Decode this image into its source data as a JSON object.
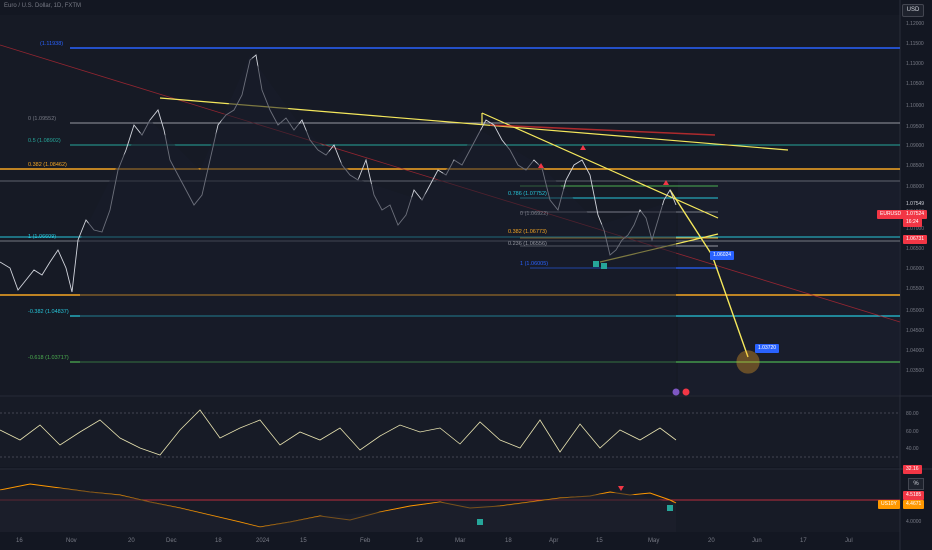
{
  "header": {
    "title": "Euro / U.S. Dollar, 1D, FXTM",
    "currency_button": "USD"
  },
  "price_axis": {
    "ticks": [
      "1.12000",
      "1.11500",
      "1.11000",
      "1.10500",
      "1.10000",
      "1.09500",
      "1.09000",
      "1.08500",
      "1.08000",
      "1.07500",
      "1.07000",
      "1.06500",
      "1.06000",
      "1.05500",
      "1.05000",
      "1.04500",
      "1.04000",
      "1.03500"
    ],
    "current_price": "1.07549",
    "symbol_tag": "EURUSD",
    "symbol_price": "1.07524",
    "countdown": "16:24",
    "level_tag": "1.06731"
  },
  "fib_labels": {
    "left_top": "(1.11938)",
    "left_1": "0 (1.09552)",
    "left_2": "0.5 (1.08902)",
    "left_3": "0.382 (1.08462)",
    "left_4": "1 (1.06609)",
    "left_5": "-0.382 (1.04837)",
    "left_6": "-0.618 (1.03717)",
    "mid_1": "0.786 (1.07752)",
    "mid_2": "0 (1.06922)",
    "mid_3": "0.382 (1.06773)",
    "mid_4": "0.236 (1.06556)",
    "mid_5": "1 (1.06005)"
  },
  "callouts": {
    "target_1": "1.06024",
    "target_2": "1.03720"
  },
  "time_axis": [
    "16",
    "Nov",
    "20",
    "Dec",
    "18",
    "2024",
    "15",
    "Feb",
    "19",
    "Mar",
    "18",
    "Apr",
    "15",
    "May",
    "20",
    "Jun",
    "17",
    "Jul"
  ],
  "rsi_panel": {
    "ticks": [
      "80.00",
      "60.00",
      "40.00"
    ],
    "tag_value": "32.16"
  },
  "osc_panel": {
    "button": "%",
    "tag_1": "4.5185",
    "tag_2": "4.4671",
    "label": "US10Y",
    "tick": "4.0000"
  },
  "colors": {
    "background": "#131722",
    "blue_line": "#2962ff",
    "yellow_line": "#f5e85c",
    "orange_line": "#f5a623",
    "teal_line": "#26c6da",
    "green_line": "#4caf50",
    "red_line": "#f23645"
  },
  "icons": [
    "flag-icon",
    "calendar-icon",
    "arrow-up-icon",
    "arrow-down-icon",
    "target-circle-icon"
  ]
}
